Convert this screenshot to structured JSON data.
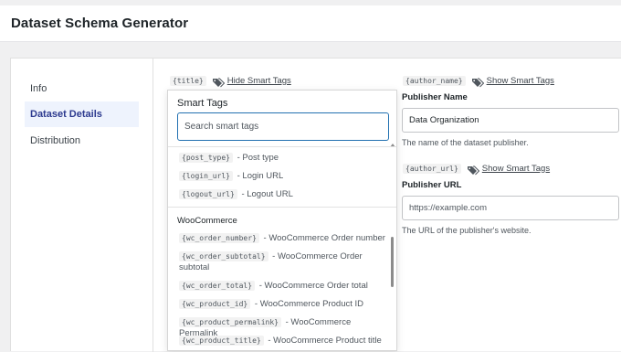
{
  "app": {
    "title": "Dataset Schema Generator"
  },
  "nav": {
    "items": [
      {
        "label": "Info"
      },
      {
        "label": "Dataset Details"
      },
      {
        "label": "Distribution"
      }
    ]
  },
  "smart_tags": {
    "title_tag": "{title}",
    "hide_label": "Hide Smart Tags",
    "show_label": "Show Smart Tags",
    "author_name_tag": "{author_name}",
    "author_url_tag": "{author_url}"
  },
  "dropdown": {
    "title": "Smart Tags",
    "search_placeholder": "Search smart tags",
    "items_top": [
      {
        "tag": "{post_type}",
        "desc": "- Post type"
      },
      {
        "tag": "{login_url}",
        "desc": "- Login URL"
      },
      {
        "tag": "{logout_url}",
        "desc": "- Logout URL"
      }
    ],
    "group_label": "WooCommerce",
    "items_woo": [
      {
        "tag": "{wc_order_number}",
        "desc": "- WooCommerce Order number"
      },
      {
        "tag": "{wc_order_subtotal}",
        "desc": "- WooCommerce Order subtotal"
      },
      {
        "tag": "{wc_order_total}",
        "desc": "- WooCommerce Order total"
      },
      {
        "tag": "{wc_product_id}",
        "desc": "- WooCommerce Product ID"
      },
      {
        "tag": "{wc_product_permalink}",
        "desc": "- WooCommerce Permalink"
      },
      {
        "tag": "{wc_product_title}",
        "desc": "- WooCommerce Product title"
      }
    ]
  },
  "publisher_name": {
    "label": "Publisher Name",
    "value": "Data Organization",
    "help": "The name of the dataset publisher."
  },
  "publisher_url": {
    "label": "Publisher URL",
    "placeholder": "https://example.com",
    "help": "The URL of the publisher's website."
  },
  "colors": {
    "accent": "#2271b1",
    "active_nav_bg": "#eef3fd",
    "active_nav_text": "#2c3a8f"
  },
  "icons": {
    "tag_icon": "tags-icon"
  }
}
